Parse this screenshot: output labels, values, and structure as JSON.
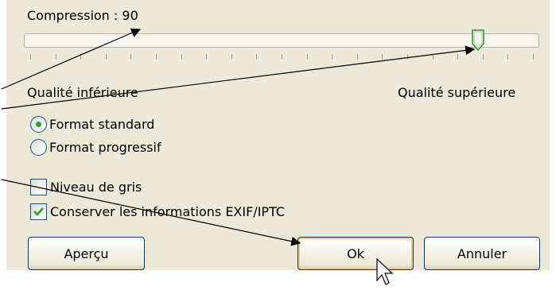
{
  "compression": {
    "label": "Compression : 90",
    "value": 90,
    "min_label": "Qualité inférieure",
    "max_label": "Qualité supérieure"
  },
  "format": {
    "standard_label": "Format standard",
    "progressive_label": "Format progressif",
    "selected": "Format standard"
  },
  "options": {
    "grayscale_label": "Niveau de gris",
    "grayscale_checked": false,
    "exif_label": "Conserver les informations EXIF/IPTC",
    "exif_checked": true
  },
  "buttons": {
    "preview_label": "Aperçu",
    "ok_label": "Ok",
    "cancel_label": "Annuler"
  },
  "colors": {
    "dialog_bg": "#ece9d8",
    "radio_dot": "#2ea02e",
    "check_mark": "#2ea02e",
    "default_button_glow": "#f4c97a"
  }
}
